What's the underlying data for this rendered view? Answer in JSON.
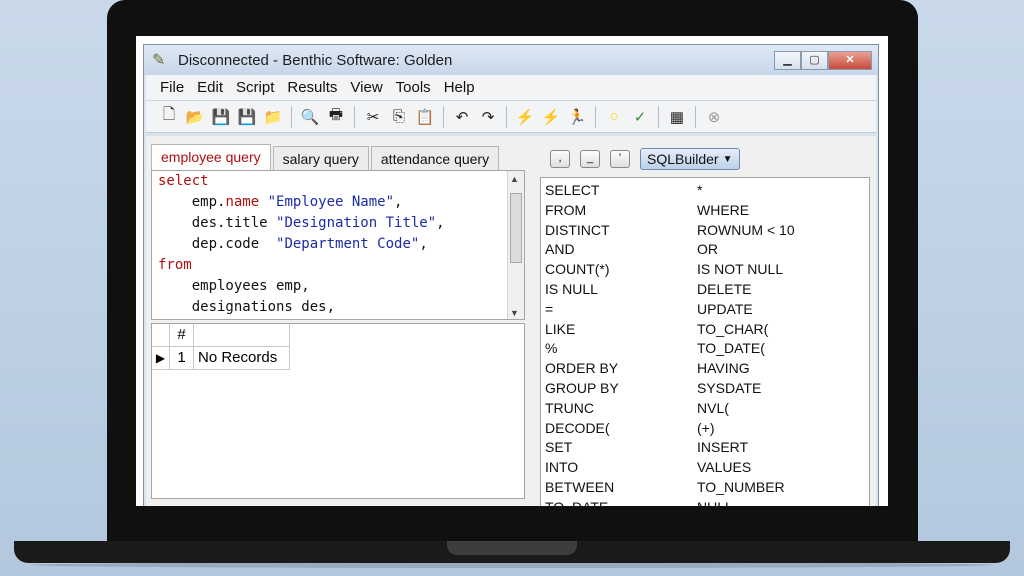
{
  "window": {
    "title": "Disconnected - Benthic Software: Golden",
    "controls": [
      "minimize",
      "maximize",
      "close"
    ]
  },
  "menu": [
    "File",
    "Edit",
    "Script",
    "Results",
    "View",
    "Tools",
    "Help"
  ],
  "toolbar_icons": [
    "new-file-icon",
    "open-folder-icon",
    "save-icon",
    "save-all-icon",
    "open-icon",
    "print-preview-icon",
    "print-icon",
    "cut-icon",
    "copy-icon",
    "paste-icon",
    "undo-icon",
    "redo-icon",
    "execute-icon",
    "execute-step-icon",
    "run-icon",
    "commit-icon",
    "rollback-icon",
    "connect-icon",
    "cancel-icon"
  ],
  "tabs": [
    {
      "label": "employee query",
      "active": true
    },
    {
      "label": "salary query",
      "active": false
    },
    {
      "label": "attendance query",
      "active": false
    }
  ],
  "editor": {
    "lines": [
      {
        "indent": "",
        "parts": [
          {
            "t": "select",
            "k": "kw"
          }
        ]
      },
      {
        "indent": "    ",
        "parts": [
          {
            "t": "emp.",
            "k": "plain"
          },
          {
            "t": "name",
            "k": "kw"
          },
          {
            "t": " \"Employee Name\"",
            "k": "str"
          },
          {
            "t": ",",
            "k": "plain"
          }
        ]
      },
      {
        "indent": "    ",
        "parts": [
          {
            "t": "des.title ",
            "k": "plain"
          },
          {
            "t": "\"Designation Title\"",
            "k": "str"
          },
          {
            "t": ",",
            "k": "plain"
          }
        ]
      },
      {
        "indent": "    ",
        "parts": [
          {
            "t": "dep.code  ",
            "k": "plain"
          },
          {
            "t": "\"Department Code\"",
            "k": "str"
          },
          {
            "t": ",",
            "k": "plain"
          }
        ]
      },
      {
        "indent": "",
        "parts": [
          {
            "t": "from",
            "k": "kw"
          }
        ]
      },
      {
        "indent": "    ",
        "parts": [
          {
            "t": "employees emp,",
            "k": "plain"
          }
        ]
      },
      {
        "indent": "    ",
        "parts": [
          {
            "t": "designations des,",
            "k": "plain"
          }
        ]
      }
    ]
  },
  "results_grid": {
    "header": "#",
    "rows": [
      {
        "num": "1",
        "value": "No Records"
      }
    ]
  },
  "right_toolbar": {
    "buttons": [
      ",",
      "_",
      "'"
    ],
    "dropdown": "SQLBuilder"
  },
  "keywords": [
    [
      "SELECT",
      "*"
    ],
    [
      "FROM",
      "WHERE"
    ],
    [
      "DISTINCT",
      "ROWNUM < 10"
    ],
    [
      "AND",
      "OR"
    ],
    [
      "COUNT(*)",
      "IS NOT NULL"
    ],
    [
      "IS NULL",
      "DELETE"
    ],
    [
      "=",
      "UPDATE"
    ],
    [
      "LIKE",
      "TO_CHAR("
    ],
    [
      "%",
      "TO_DATE("
    ],
    [
      "ORDER BY",
      "HAVING"
    ],
    [
      "GROUP BY",
      "SYSDATE"
    ],
    [
      "TRUNC",
      "NVL("
    ],
    [
      "DECODE(",
      "(+)"
    ],
    [
      "SET",
      "INSERT"
    ],
    [
      "INTO",
      "VALUES"
    ],
    [
      "BETWEEN",
      "TO_NUMBER"
    ],
    [
      "TO_DATE",
      "NULL"
    ]
  ],
  "colors": {
    "keyword": "#b01010",
    "string": "#1a2aa8",
    "active_tab": "#b01010"
  }
}
